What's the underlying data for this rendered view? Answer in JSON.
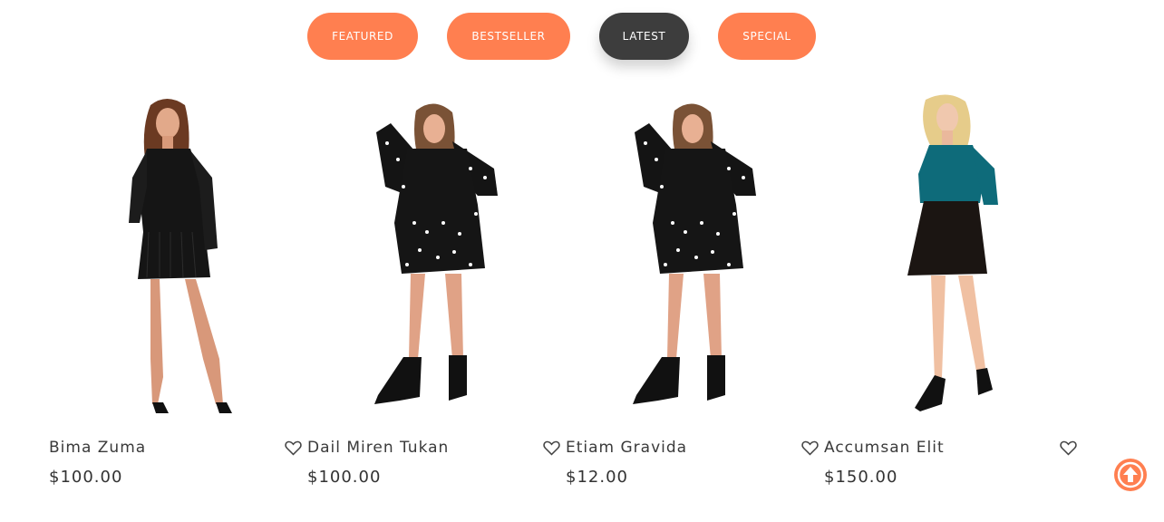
{
  "tabs": [
    {
      "label": "FEATURED"
    },
    {
      "label": "BESTSELLER"
    },
    {
      "label": "LATEST"
    },
    {
      "label": "SPECIAL"
    }
  ],
  "active_tab": "LATEST",
  "products": [
    {
      "name": "Bima Zuma",
      "price": "$100.00"
    },
    {
      "name": "Dail Miren Tukan",
      "price": "$100.00"
    },
    {
      "name": "Etiam Gravida",
      "price": "$12.00"
    },
    {
      "name": "Accumsan Elit",
      "price": "$150.00"
    }
  ],
  "colors": {
    "accent": "#ff7f50",
    "active_tab": "#3d3d3d",
    "text": "#333333"
  },
  "icons": {
    "wishlist": "heart-icon",
    "scroll_top": "arrow-up-circle-icon"
  }
}
